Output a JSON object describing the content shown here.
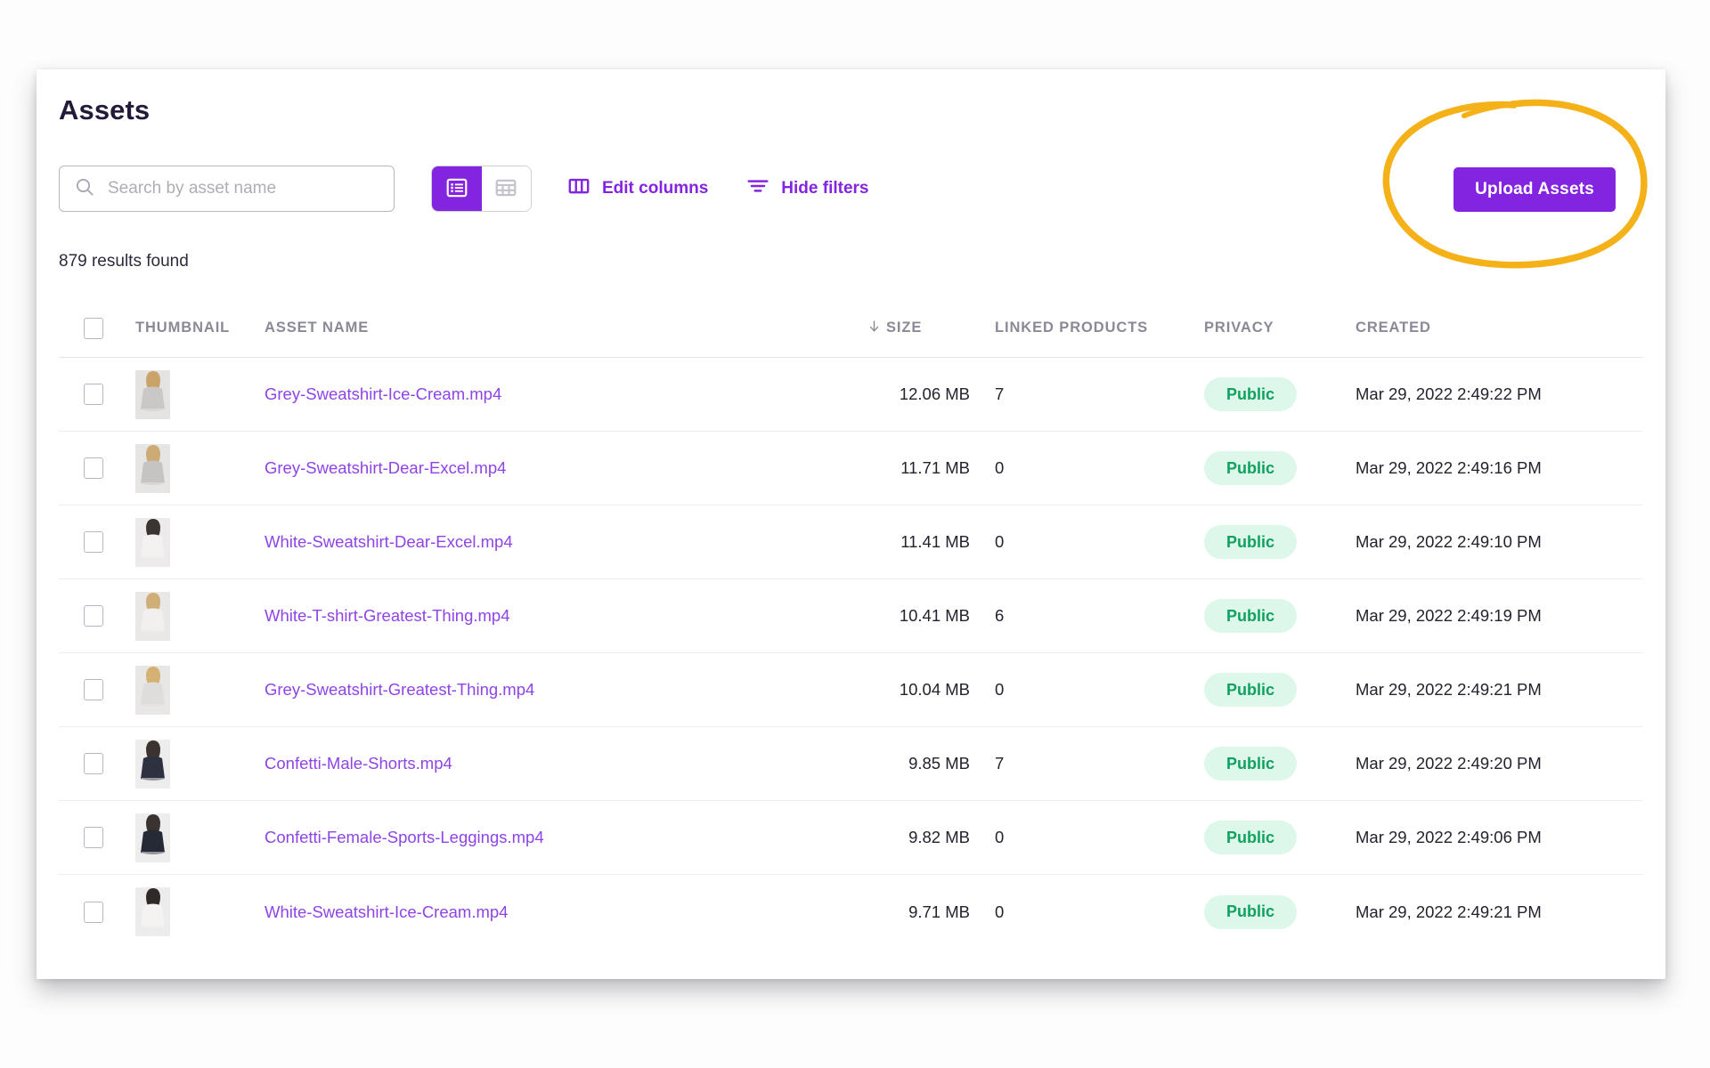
{
  "page": {
    "title": "Assets",
    "results_text": "879 results found"
  },
  "toolbar": {
    "search_placeholder": "Search by asset name",
    "search_value": "",
    "search_icon": "search-icon",
    "view_list_icon": "list-view-icon",
    "view_grid_icon": "grid-view-icon",
    "view_active": "list",
    "edit_columns_label": "Edit columns",
    "edit_columns_icon": "columns-icon",
    "hide_filters_label": "Hide filters",
    "hide_filters_icon": "filter-icon",
    "upload_label": "Upload Assets"
  },
  "annotation": {
    "type": "hand-drawn-ellipse",
    "color": "#f5b118",
    "target": "Upload Assets"
  },
  "colors": {
    "accent_purple": "#8324e0",
    "link_purple": "#8e44e6",
    "badge_bg": "#ddf8ea",
    "badge_text": "#10a05f",
    "annotation_orange": "#f5b118",
    "title_ink": "#231a3a"
  },
  "table": {
    "headers": {
      "select_all": "",
      "thumbnail": "THUMBNAIL",
      "asset_name": "ASSET NAME",
      "size": "SIZE",
      "linked_products": "LINKED PRODUCTS",
      "privacy": "PRIVACY",
      "created": "CREATED"
    },
    "sort": {
      "column": "SIZE",
      "direction": "descending",
      "icon": "arrow-down-icon"
    },
    "rows": [
      {
        "name": "Grey-Sweatshirt-Ice-Cream.mp4",
        "size": "12.06 MB",
        "linked_products": "7",
        "privacy": "Public",
        "created": "Mar 29, 2022 2:49:22 PM",
        "thumbnail_alt": "woman in grey sweatshirt"
      },
      {
        "name": "Grey-Sweatshirt-Dear-Excel.mp4",
        "size": "11.71 MB",
        "linked_products": "0",
        "privacy": "Public",
        "created": "Mar 29, 2022 2:49:16 PM",
        "thumbnail_alt": "woman in grey sweatshirt side view"
      },
      {
        "name": "White-Sweatshirt-Dear-Excel.mp4",
        "size": "11.41 MB",
        "linked_products": "0",
        "privacy": "Public",
        "created": "Mar 29, 2022 2:49:10 PM",
        "thumbnail_alt": "man in white sweatshirt"
      },
      {
        "name": "White-T-shirt-Greatest-Thing.mp4",
        "size": "10.41 MB",
        "linked_products": "6",
        "privacy": "Public",
        "created": "Mar 29, 2022 2:49:19 PM",
        "thumbnail_alt": "woman in white t-shirt"
      },
      {
        "name": "Grey-Sweatshirt-Greatest-Thing.mp4",
        "size": "10.04 MB",
        "linked_products": "0",
        "privacy": "Public",
        "created": "Mar 29, 2022 2:49:21 PM",
        "thumbnail_alt": "woman with blonde hair back view"
      },
      {
        "name": "Confetti-Male-Shorts.mp4",
        "size": "9.85 MB",
        "linked_products": "7",
        "privacy": "Public",
        "created": "Mar 29, 2022 2:49:20 PM",
        "thumbnail_alt": "man in patterned shorts"
      },
      {
        "name": "Confetti-Female-Sports-Leggings.mp4",
        "size": "9.82 MB",
        "linked_products": "0",
        "privacy": "Public",
        "created": "Mar 29, 2022 2:49:06 PM",
        "thumbnail_alt": "woman in patterned leggings"
      },
      {
        "name": "White-Sweatshirt-Ice-Cream.mp4",
        "size": "9.71 MB",
        "linked_products": "0",
        "privacy": "Public",
        "created": "Mar 29, 2022 2:49:21 PM",
        "thumbnail_alt": "man in white sweatshirt"
      }
    ]
  }
}
